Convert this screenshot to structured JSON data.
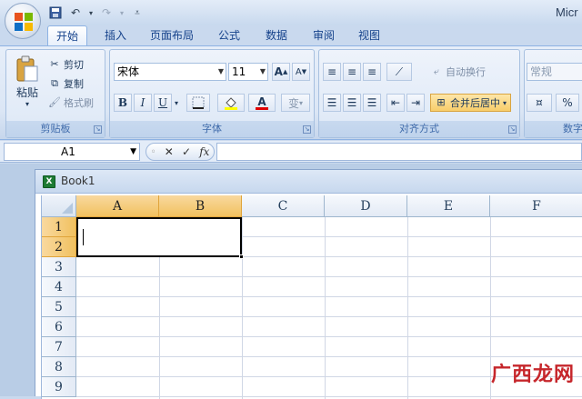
{
  "app": {
    "title": "Micr"
  },
  "quick_access": {
    "save_icon": "save-icon",
    "undo_icon": "undo-icon",
    "redo_icon": "redo-icon",
    "customize_icon": "customize-icon"
  },
  "tabs": [
    "开始",
    "插入",
    "页面布局",
    "公式",
    "数据",
    "审阅",
    "视图"
  ],
  "active_tab": "开始",
  "ribbon": {
    "clipboard": {
      "label": "剪贴板",
      "paste": "粘贴",
      "cut": "剪切",
      "copy": "复制",
      "format_painter": "格式刷"
    },
    "font": {
      "label": "字体",
      "font_name": "宋体",
      "font_size": "11",
      "bold": "B",
      "italic": "I",
      "underline": "U",
      "font_color_glyph": "A",
      "grow_glyph": "A",
      "shrink_glyph": "A",
      "phonetic_glyph": "变"
    },
    "alignment": {
      "label": "对齐方式",
      "wrap_text": "自动换行",
      "merge_center": "合并后居中"
    },
    "number": {
      "label": "数字",
      "format": "常规",
      "percent": "%"
    }
  },
  "formula_bar": {
    "name_box": "A1",
    "cancel": "✕",
    "enter": "✓",
    "fx": "fx",
    "content": ""
  },
  "workbook": {
    "name": "Book1",
    "columns": [
      "A",
      "B",
      "C",
      "D",
      "E",
      "F"
    ],
    "rows": [
      "1",
      "2",
      "3",
      "4",
      "5",
      "6",
      "7",
      "8",
      "9"
    ],
    "selected_columns": [
      "A",
      "B"
    ],
    "selected_rows": [
      "1",
      "2"
    ],
    "merged_range": "A1:B2"
  },
  "watermark": "广西龙网",
  "colors": {
    "selection_header": "#f1c15f",
    "ribbon_bg": "#dbe6f5",
    "watermark": "#c6262b"
  }
}
